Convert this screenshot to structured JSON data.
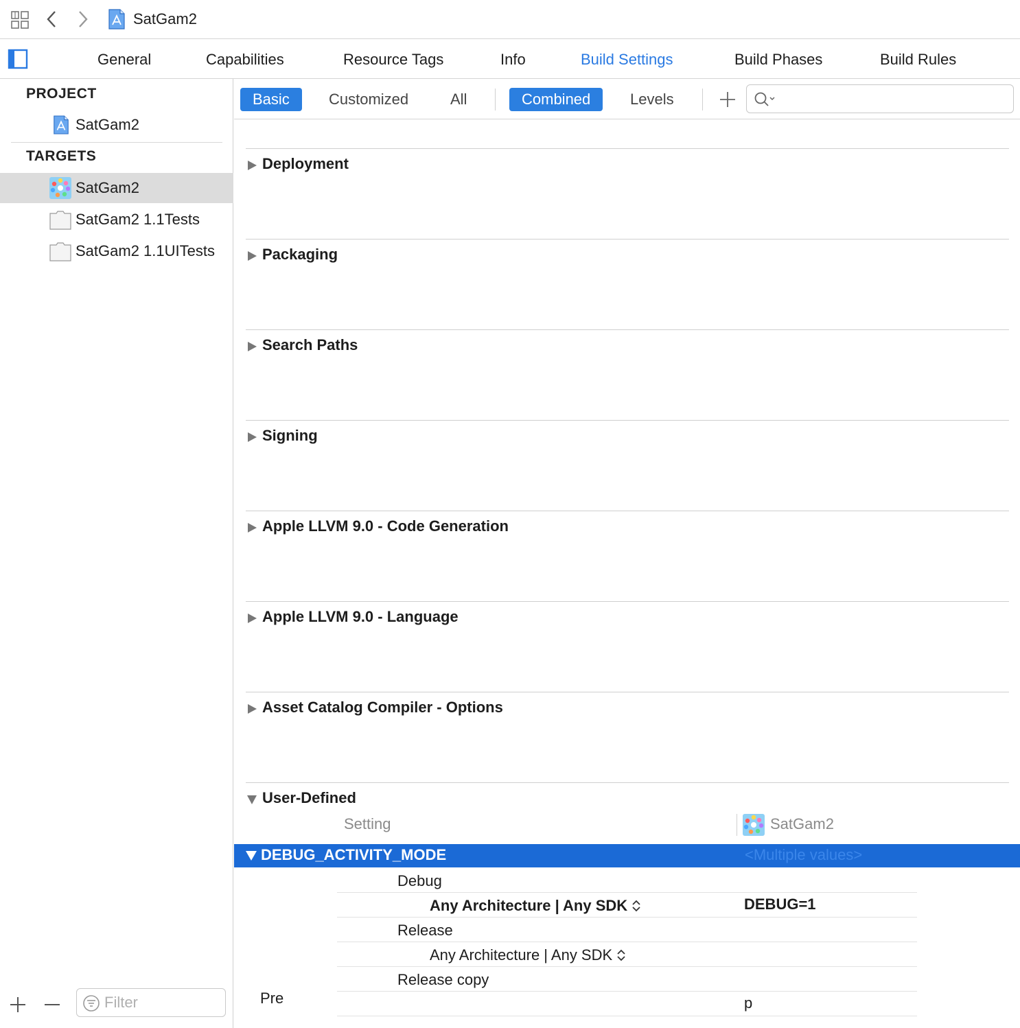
{
  "jumpbar": {
    "project_name": "SatGam2"
  },
  "tabs": [
    "General",
    "Capabilities",
    "Resource Tags",
    "Info",
    "Build Settings",
    "Build Phases",
    "Build Rules"
  ],
  "active_tab": "Build Settings",
  "sidebar": {
    "project_header": "PROJECT",
    "project_item": "SatGam2",
    "targets_header": "TARGETS",
    "targets": [
      {
        "label": "SatGam2",
        "icon": "app-target-icon",
        "selected": true
      },
      {
        "label": "SatGam2 1.1Tests",
        "icon": "test-bundle-icon",
        "selected": false
      },
      {
        "label": "SatGam2 1.1UITests",
        "icon": "test-bundle-icon",
        "selected": false
      }
    ],
    "filter_placeholder": "Filter"
  },
  "filterbar": {
    "scope": [
      "Basic",
      "Customized",
      "All"
    ],
    "scope_selected": "Basic",
    "view": [
      "Combined",
      "Levels"
    ],
    "view_selected": "Combined",
    "search_value": ""
  },
  "groups": [
    "Deployment",
    "Packaging",
    "Search Paths",
    "Signing",
    "Apple LLVM 9.0 - Code Generation",
    "Apple LLVM 9.0 - Language",
    "Asset Catalog Compiler - Options"
  ],
  "user_defined": {
    "title": "User-Defined",
    "col_setting": "Setting",
    "col_target": "SatGam2",
    "selected_key": "DEBUG_ACTIVITY_MODE",
    "selected_value": "<Multiple values>",
    "rows": [
      {
        "label": "Debug",
        "value": ""
      },
      {
        "label": "Any Architecture | Any SDK",
        "value": "DEBUG=1"
      },
      {
        "label": "Release",
        "value": ""
      },
      {
        "label": "Any Architecture | Any SDK",
        "value": ""
      },
      {
        "label": "Release copy",
        "value": ""
      },
      {
        "label": "",
        "value": "p"
      }
    ],
    "partial_key": "Pre"
  },
  "colors": {
    "accent": "#2a7ae2",
    "selection": "#1b6ad6",
    "sidebar_selected": "#dcdcdc"
  }
}
